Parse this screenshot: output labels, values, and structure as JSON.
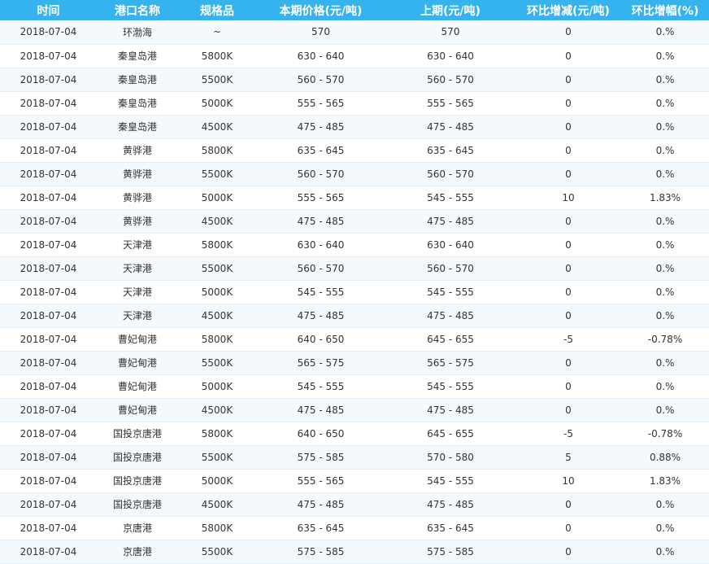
{
  "table": {
    "headers": [
      "时间",
      "港口名称",
      "规格品",
      "本期价格(元/吨)",
      "上期(元/吨)",
      "环比增减(元/吨)",
      "环比增幅(%)"
    ],
    "rows": [
      [
        "2018-07-04",
        "环渤海",
        "~",
        "570",
        "570",
        "0",
        "0.%"
      ],
      [
        "2018-07-04",
        "秦皇岛港",
        "5800K",
        "630 - 640",
        "630 - 640",
        "0",
        "0.%"
      ],
      [
        "2018-07-04",
        "秦皇岛港",
        "5500K",
        "560 - 570",
        "560 - 570",
        "0",
        "0.%"
      ],
      [
        "2018-07-04",
        "秦皇岛港",
        "5000K",
        "555 - 565",
        "555 - 565",
        "0",
        "0.%"
      ],
      [
        "2018-07-04",
        "秦皇岛港",
        "4500K",
        "475 - 485",
        "475 - 485",
        "0",
        "0.%"
      ],
      [
        "2018-07-04",
        "黄骅港",
        "5800K",
        "635 - 645",
        "635 - 645",
        "0",
        "0.%"
      ],
      [
        "2018-07-04",
        "黄骅港",
        "5500K",
        "560 - 570",
        "560 - 570",
        "0",
        "0.%"
      ],
      [
        "2018-07-04",
        "黄骅港",
        "5000K",
        "555 - 565",
        "545 - 555",
        "10",
        "1.83%"
      ],
      [
        "2018-07-04",
        "黄骅港",
        "4500K",
        "475 - 485",
        "475 - 485",
        "0",
        "0.%"
      ],
      [
        "2018-07-04",
        "天津港",
        "5800K",
        "630 - 640",
        "630 - 640",
        "0",
        "0.%"
      ],
      [
        "2018-07-04",
        "天津港",
        "5500K",
        "560 - 570",
        "560 - 570",
        "0",
        "0.%"
      ],
      [
        "2018-07-04",
        "天津港",
        "5000K",
        "545 - 555",
        "545 - 555",
        "0",
        "0.%"
      ],
      [
        "2018-07-04",
        "天津港",
        "4500K",
        "475 - 485",
        "475 - 485",
        "0",
        "0.%"
      ],
      [
        "2018-07-04",
        "曹妃甸港",
        "5800K",
        "640 - 650",
        "645 - 655",
        "-5",
        "-0.78%"
      ],
      [
        "2018-07-04",
        "曹妃甸港",
        "5500K",
        "565 - 575",
        "565 - 575",
        "0",
        "0.%"
      ],
      [
        "2018-07-04",
        "曹妃甸港",
        "5000K",
        "545 - 555",
        "545 - 555",
        "0",
        "0.%"
      ],
      [
        "2018-07-04",
        "曹妃甸港",
        "4500K",
        "475 - 485",
        "475 - 485",
        "0",
        "0.%"
      ],
      [
        "2018-07-04",
        "国投京唐港",
        "5800K",
        "640 - 650",
        "645 - 655",
        "-5",
        "-0.78%"
      ],
      [
        "2018-07-04",
        "国投京唐港",
        "5500K",
        "575 - 585",
        "570 - 580",
        "5",
        "0.88%"
      ],
      [
        "2018-07-04",
        "国投京唐港",
        "5000K",
        "555 - 565",
        "545 - 555",
        "10",
        "1.83%"
      ],
      [
        "2018-07-04",
        "国投京唐港",
        "4500K",
        "475 - 485",
        "475 - 485",
        "0",
        "0.%"
      ],
      [
        "2018-07-04",
        "京唐港",
        "5800K",
        "635 - 645",
        "635 - 645",
        "0",
        "0.%"
      ],
      [
        "2018-07-04",
        "京唐港",
        "5500K",
        "575 - 585",
        "575 - 585",
        "0",
        "0.%"
      ]
    ]
  },
  "colors": {
    "header_bg": "#35b3ee",
    "header_text": "#ffffff",
    "row_alt_bg": "#f3f9fd",
    "row_bg": "#ffffff",
    "cell_text": "#333333"
  }
}
